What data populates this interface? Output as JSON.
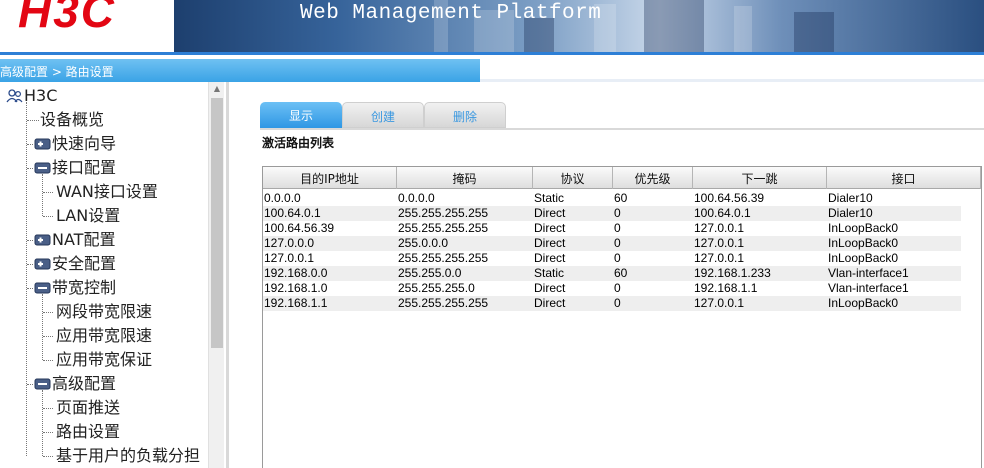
{
  "header": {
    "logo": "H3C",
    "title": "Web Management Platform"
  },
  "breadcrumb": "高级配置 > 路由设置",
  "sidebar": {
    "root": "H3C",
    "items": [
      {
        "label": "设备概览",
        "level": 1,
        "type": "leaf"
      },
      {
        "label": "快速向导",
        "level": 1,
        "type": "closed"
      },
      {
        "label": "接口配置",
        "level": 1,
        "type": "open"
      },
      {
        "label": "WAN接口设置",
        "level": 2,
        "type": "leaf"
      },
      {
        "label": "LAN设置",
        "level": 2,
        "type": "leaf"
      },
      {
        "label": "NAT配置",
        "level": 1,
        "type": "closed"
      },
      {
        "label": "安全配置",
        "level": 1,
        "type": "closed"
      },
      {
        "label": "带宽控制",
        "level": 1,
        "type": "open"
      },
      {
        "label": "网段带宽限速",
        "level": 2,
        "type": "leaf"
      },
      {
        "label": "应用带宽限速",
        "level": 2,
        "type": "leaf"
      },
      {
        "label": "应用带宽保证",
        "level": 2,
        "type": "leaf"
      },
      {
        "label": "高级配置",
        "level": 1,
        "type": "open"
      },
      {
        "label": "页面推送",
        "level": 2,
        "type": "leaf"
      },
      {
        "label": "路由设置",
        "level": 2,
        "type": "leaf"
      },
      {
        "label": "基于用户的负载分担",
        "level": 2,
        "type": "leaf"
      }
    ]
  },
  "tabs": [
    "显示",
    "创建",
    "删除"
  ],
  "section_title": "激活路由列表",
  "table": {
    "columns": [
      "目的IP地址",
      "掩码",
      "协议",
      "优先级",
      "下一跳",
      "接口"
    ],
    "rows": [
      [
        "0.0.0.0",
        "0.0.0.0",
        "Static",
        "60",
        "100.64.56.39",
        "Dialer10"
      ],
      [
        "100.64.0.1",
        "255.255.255.255",
        "Direct",
        "0",
        "100.64.0.1",
        "Dialer10"
      ],
      [
        "100.64.56.39",
        "255.255.255.255",
        "Direct",
        "0",
        "127.0.0.1",
        "InLoopBack0"
      ],
      [
        "127.0.0.0",
        "255.0.0.0",
        "Direct",
        "0",
        "127.0.0.1",
        "InLoopBack0"
      ],
      [
        "127.0.0.1",
        "255.255.255.255",
        "Direct",
        "0",
        "127.0.0.1",
        "InLoopBack0"
      ],
      [
        "192.168.0.0",
        "255.255.0.0",
        "Static",
        "60",
        "192.168.1.233",
        "Vlan-interface1"
      ],
      [
        "192.168.1.0",
        "255.255.255.0",
        "Direct",
        "0",
        "192.168.1.1",
        "Vlan-interface1"
      ],
      [
        "192.168.1.1",
        "255.255.255.255",
        "Direct",
        "0",
        "127.0.0.1",
        "InLoopBack0"
      ]
    ]
  },
  "colors": {
    "brand_red": "#e30613",
    "accent_blue": "#2f97e4"
  }
}
